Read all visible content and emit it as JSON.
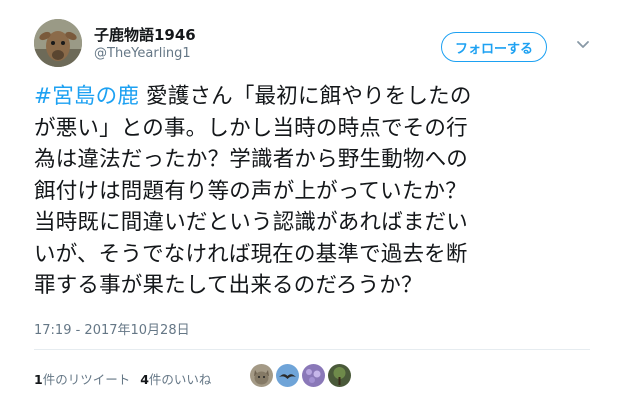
{
  "user": {
    "display_name": "子鹿物語1946",
    "handle": "@TheYearling1",
    "avatar_icon": "deer-avatar"
  },
  "follow": {
    "label": "フォローする",
    "accent": "#1da1f2"
  },
  "menu": {
    "icon": "chevron-down-icon"
  },
  "tweet": {
    "hashtag": "#宮島の鹿",
    "line1_rest": " 愛護さん「最初に餌やりをしたの",
    "line2": "が悪い」との事。しかし当時の時点でその行",
    "line3": "為は違法だったか？学識者から野生動物への",
    "line4": "餌付けは問題有り等の声が上がっていたか？",
    "line5": "当時既に間違いだという認識があればまだい",
    "line6": "いが、そうでなければ現在の基準で過去を断",
    "line7": "罪する事が果たして出来るのだろうか？"
  },
  "timestamp": "17:19 - 2017年10月28日",
  "stats": {
    "retweets_count": "1",
    "retweets_label": "件のリツイート",
    "likes_count": "4",
    "likes_label": "件のいいね"
  },
  "likers": [
    "cat-avatar",
    "bird-avatar",
    "flower-avatar",
    "tree-avatar"
  ]
}
